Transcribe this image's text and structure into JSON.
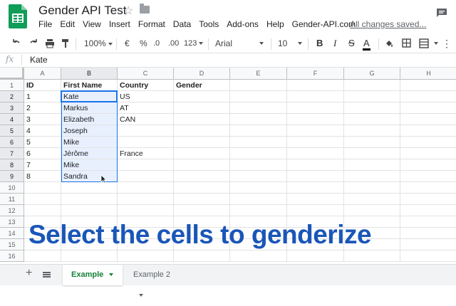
{
  "title_bar": {
    "doc_title": "Gender API Test",
    "status": "All changes saved...",
    "menu": [
      "File",
      "Edit",
      "View",
      "Insert",
      "Format",
      "Data",
      "Tools",
      "Add-ons",
      "Help",
      "Gender-API.com"
    ]
  },
  "toolbar": {
    "zoom": "100%",
    "currency": "€",
    "percent": "%",
    "decimal_decrease": ".0",
    "decimal_increase": ".00",
    "more_formats": "123",
    "font": "Arial",
    "font_size": "10",
    "bold": "B",
    "italic": "I",
    "text_color": "A"
  },
  "formula_bar": {
    "fx_label": "fx",
    "value": "Kate"
  },
  "grid": {
    "columns": [
      "A",
      "B",
      "C",
      "D",
      "E",
      "F",
      "G",
      "H"
    ],
    "rows": [
      "1",
      "2",
      "3",
      "4",
      "5",
      "6",
      "7",
      "8",
      "9",
      "10",
      "11",
      "12",
      "13",
      "14",
      "15",
      "16"
    ],
    "selected_column": "B",
    "cells": [
      [
        "ID",
        "First Name",
        "Country",
        "Gender"
      ],
      [
        "1",
        "Kate",
        "US",
        ""
      ],
      [
        "2",
        "Markus",
        "AT",
        ""
      ],
      [
        "3",
        "Elizabeth",
        "CAN",
        ""
      ],
      [
        "4",
        "Joseph",
        "",
        ""
      ],
      [
        "5",
        "Mike",
        "",
        ""
      ],
      [
        "6",
        "Jérôme",
        "France",
        ""
      ],
      [
        "7",
        "Mike",
        "",
        ""
      ],
      [
        "8",
        "Sandra",
        "",
        ""
      ]
    ]
  },
  "caption": "Select the cells to genderize",
  "sheets": {
    "tabs": [
      "Example",
      "Example 2"
    ],
    "active": "Example"
  },
  "colors": {
    "accent": "#1a73e8",
    "selection": "#e8f0fe",
    "caption": "#1a56b8",
    "active_tab": "#188038",
    "logo": "#0f9d58"
  }
}
